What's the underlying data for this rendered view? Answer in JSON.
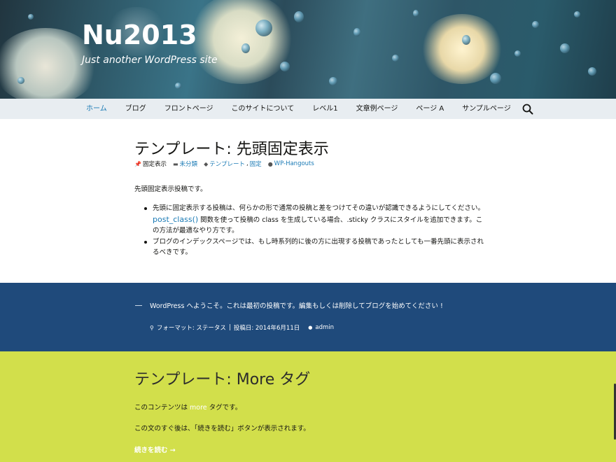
{
  "site": {
    "title": "Nu2013",
    "description": "Just another WordPress site"
  },
  "nav": {
    "items": [
      "ホーム",
      "ブログ",
      "フロントページ",
      "このサイトについて",
      "レベル1",
      "文章例ページ",
      "ページ A",
      "サンプルページ"
    ],
    "active_index": 0,
    "search_icon": "search-icon"
  },
  "post1": {
    "title": "テンプレート: 先頭固定表示",
    "meta": {
      "sticky": "固定表示",
      "category": "未分類",
      "tags": "テンプレート",
      "tags_sep": ",",
      "tag2": "固定",
      "author": "WP-Hangouts"
    },
    "lead": "先頭固定表示投稿です。",
    "bullet1_a": "先頭に固定表示する投稿は、何らかの形で通常の投稿と差をつけてその違いが認識できるようにしてください。",
    "bullet1_link": "post_class()",
    "bullet1_b": " 関数を使って投稿の class を生成している場合、.sticky クラスにスタイルを追加できます。この方法が最適なやり方です。",
    "bullet2": "ブログのインデックスページでは、もし時系列的に後の方に出現する投稿であったとしても一番先頭に表示されるべきです。"
  },
  "post2": {
    "text": "WordPress へようこそ。これは最初の投稿です。編集もしくは削除してブログを始めてください !",
    "format": "フォーマット: ステータス",
    "sep": "|",
    "date": "投稿日: 2014年6月11日",
    "author": "admin"
  },
  "post3": {
    "title": "テンプレート: More タグ",
    "line1_a": "このコンテンツは ",
    "line1_more": "more",
    "line1_b": " タグです。",
    "line2": "この文のすぐ後は、「続きを読む」ボタンが表示されます。",
    "read_more": "続きを読む →"
  },
  "colors": {
    "link": "#1a7ab5",
    "nav_bg": "#e8edf1",
    "status_bg": "#1f4a7b",
    "more_bg": "#d2df4b"
  }
}
